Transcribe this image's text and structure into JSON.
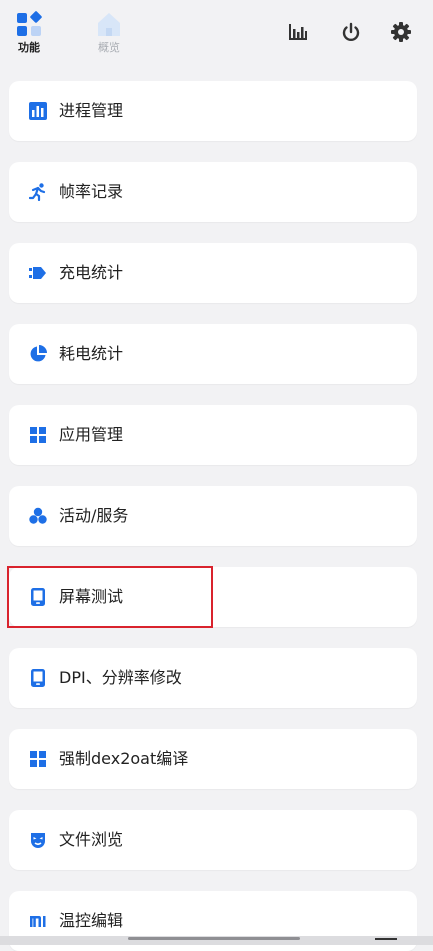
{
  "tabs": [
    {
      "label": "功能",
      "icon": "function-grid-icon",
      "active": true
    },
    {
      "label": "概览",
      "icon": "home-icon",
      "active": false
    }
  ],
  "toolbar": [
    {
      "icon": "bar-chart-icon"
    },
    {
      "icon": "power-icon"
    },
    {
      "icon": "settings-gear-icon"
    }
  ],
  "menu": [
    {
      "label": "进程管理",
      "icon": "bar-chart-icon"
    },
    {
      "label": "帧率记录",
      "icon": "running-person-icon"
    },
    {
      "label": "充电统计",
      "icon": "charging-plug-icon"
    },
    {
      "label": "耗电统计",
      "icon": "pie-chart-icon"
    },
    {
      "label": "应用管理",
      "icon": "apps-grid-icon"
    },
    {
      "label": "活动/服务",
      "icon": "bubbles-icon"
    },
    {
      "label": "屏幕测试",
      "icon": "tablet-icon"
    },
    {
      "label": "DPI、分辨率修改",
      "icon": "tablet-icon"
    },
    {
      "label": "强制dex2oat编译",
      "icon": "apps-grid-icon"
    },
    {
      "label": "文件浏览",
      "icon": "mask-icon"
    },
    {
      "label": "温控编辑",
      "icon": "mi-logo-icon"
    }
  ],
  "colors": {
    "accent": "#1e6fe6",
    "accent_light": "#bcd3f5",
    "highlight": "#d9232d",
    "text": "#222222",
    "inactive": "#a9adb3"
  }
}
